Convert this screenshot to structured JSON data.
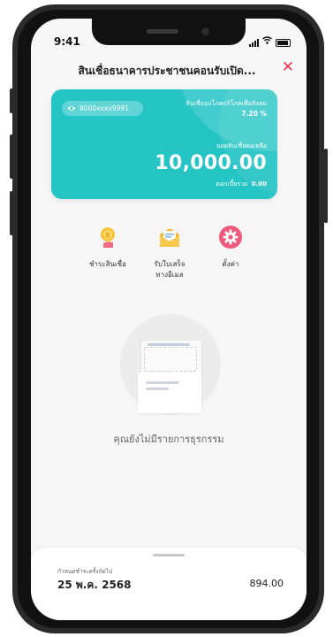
{
  "status_bar": {
    "time": "9:41"
  },
  "header": {
    "title": "สินเชื่อธนาคารประชาชนคอนรับเปิด...",
    "close_label": "✕"
  },
  "loan_card": {
    "account_number": "8000xxxx9991",
    "loan_type": "สินเชื่ออุปโภคบริโภคเพื่อสังคม",
    "interest_rate": "7.20 %",
    "balance_label": "ยอดสินเชื่อคงเหลือ",
    "balance": "10,000.00",
    "accrued_interest_label": "ดอกเบี้ยรวม",
    "accrued_interest": "0.00",
    "color": "#25c4c5"
  },
  "actions": [
    {
      "label": "ชำระสินเชื่อ",
      "icon": "coin-hand-icon"
    },
    {
      "label": "รับใบเสร็จ\nทางอีเมล",
      "icon": "mail-icon"
    },
    {
      "label": "ตั้งค่า",
      "icon": "gear-icon"
    }
  ],
  "empty_state": {
    "message": "คุณยังไม่มีรายการธุรกรรม"
  },
  "bottom_sheet": {
    "due_label": "กำหนดชำระครั้งถัดไป",
    "due_date": "25 พ.ค. 2568",
    "due_amount": "894.00"
  },
  "colors": {
    "accent": "#e8334f",
    "card": "#25c4c5"
  }
}
